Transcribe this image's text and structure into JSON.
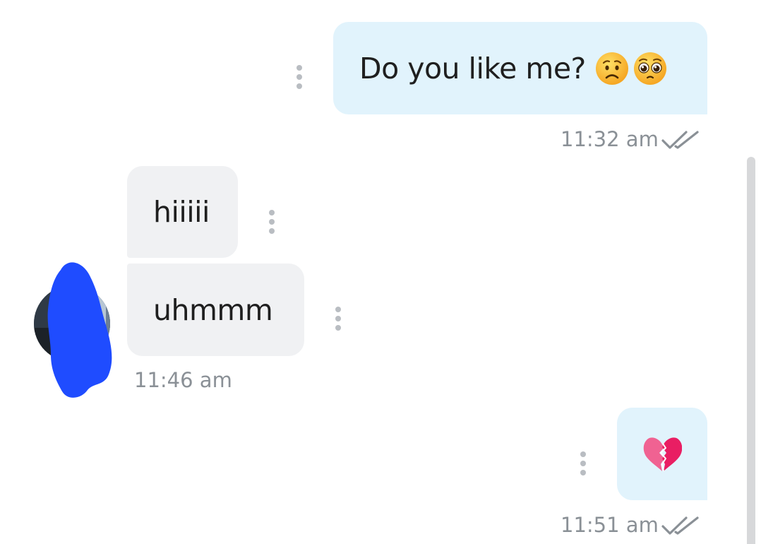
{
  "messages": [
    {
      "direction": "outgoing",
      "text": "Do you like me?",
      "emojis": [
        "worried-face",
        "pleading-face"
      ],
      "time": "11:32 am",
      "status": "read"
    },
    {
      "direction": "incoming",
      "text": "hiiiii"
    },
    {
      "direction": "incoming",
      "text": "uhmmm",
      "time": "11:46 am"
    },
    {
      "direction": "outgoing",
      "emoji": "💔",
      "emoji_name": "broken-heart",
      "time": "11:51 am",
      "status": "read"
    }
  ],
  "colors": {
    "outgoing_bubble": "#e1f3fc",
    "incoming_bubble": "#f0f1f3",
    "timestamp": "#8a9096",
    "redaction": "#1f4cff"
  },
  "icons": {
    "message_menu": "more-vertical-icon",
    "read_receipt": "double-check-icon"
  }
}
